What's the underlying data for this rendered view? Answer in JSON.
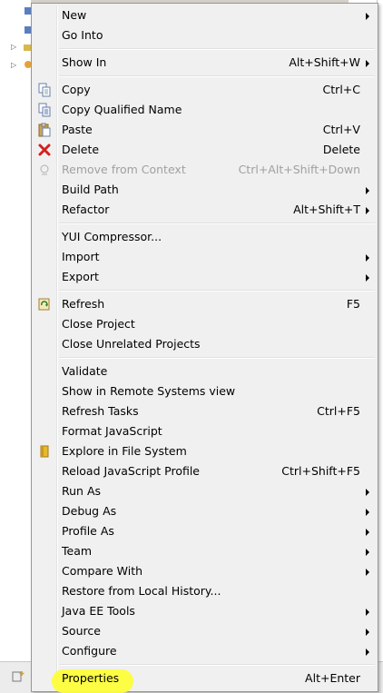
{
  "menu": {
    "new": "New",
    "go_into": "Go Into",
    "show_in": "Show In",
    "show_in_sc": "Alt+Shift+W",
    "copy": "Copy",
    "copy_sc": "Ctrl+C",
    "copy_qualified": "Copy Qualified Name",
    "paste": "Paste",
    "paste_sc": "Ctrl+V",
    "delete": "Delete",
    "delete_sc": "Delete",
    "remove_context": "Remove from Context",
    "remove_context_sc": "Ctrl+Alt+Shift+Down",
    "build_path": "Build Path",
    "refactor": "Refactor",
    "refactor_sc": "Alt+Shift+T",
    "yui": "YUI Compressor...",
    "import": "Import",
    "export": "Export",
    "refresh": "Refresh",
    "refresh_sc": "F5",
    "close_project": "Close Project",
    "close_unrelated": "Close Unrelated Projects",
    "validate": "Validate",
    "show_remote": "Show in Remote Systems view",
    "refresh_tasks": "Refresh Tasks",
    "refresh_tasks_sc": "Ctrl+F5",
    "format_js": "Format JavaScript",
    "explore_fs": "Explore in File System",
    "reload_js": "Reload JavaScript Profile",
    "reload_js_sc": "Ctrl+Shift+F5",
    "run_as": "Run As",
    "debug_as": "Debug As",
    "profile_as": "Profile As",
    "team": "Team",
    "compare_with": "Compare With",
    "restore_history": "Restore from Local History...",
    "javaee_tools": "Java EE Tools",
    "source": "Source",
    "configure": "Configure",
    "properties": "Properties",
    "properties_sc": "Alt+Enter"
  },
  "icons": {
    "copy": "copy-icon",
    "copy_qualified": "copy-qualified-icon",
    "paste": "paste-icon",
    "delete": "delete-icon",
    "remove_context": "remove-context-icon",
    "refresh": "refresh-icon",
    "explore": "folder-icon"
  },
  "colors": {
    "menu_bg": "#f0f0f0",
    "delete_red": "#d42020",
    "highlight": "#fdfd3a",
    "disabled_text": "#a0a0a0"
  }
}
